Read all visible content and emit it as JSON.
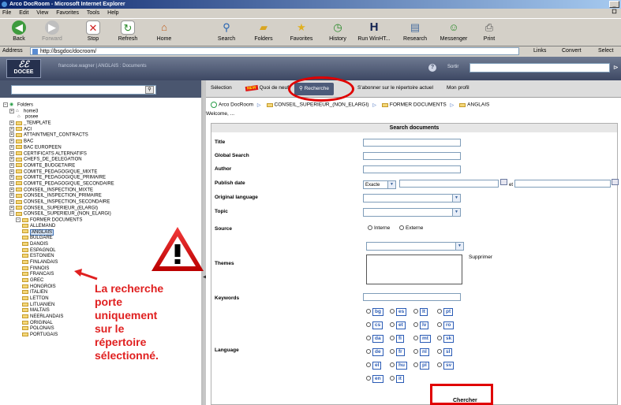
{
  "window": {
    "title": "Arco DocRoom - Microsoft Internet Explorer",
    "controls": "_ ☐"
  },
  "menu": [
    "File",
    "Edit",
    "View",
    "Favorites",
    "Tools",
    "Help"
  ],
  "toolbar": [
    {
      "label": "Back",
      "icon": "back-arrow-icon"
    },
    {
      "label": "Forward",
      "icon": "forward-arrow-icon"
    },
    {
      "label": "Stop",
      "icon": "stop-icon"
    },
    {
      "label": "Refresh",
      "icon": "refresh-icon"
    },
    {
      "label": "Home",
      "icon": "home-icon"
    },
    {
      "label": "Search",
      "icon": "search-icon"
    },
    {
      "label": "Folders",
      "icon": "folder-icon"
    },
    {
      "label": "Favorites",
      "icon": "star-icon"
    },
    {
      "label": "History",
      "icon": "history-icon"
    },
    {
      "label": "Run WinHT...",
      "icon": "h-icon"
    },
    {
      "label": "Research",
      "icon": "research-icon"
    },
    {
      "label": "Messenger",
      "icon": "messenger-icon"
    },
    {
      "label": "Print",
      "icon": "print-icon"
    }
  ],
  "address": {
    "label": "Address",
    "url": "http://bsgdoc/docroom/",
    "links": "Links",
    "convert": "Convert",
    "select": "Select"
  },
  "app": {
    "logo": "DOCEE",
    "user": "francoise.wagner  |  ANGLAIS : Documents",
    "help": "?",
    "logout": "Sortir",
    "go": "⊳"
  },
  "tabs": {
    "selection": "Sélection",
    "new_badge": "NEW",
    "quoi_de_neuf": "Quoi de neuf",
    "recherche": "Recherche",
    "sabonner": "S'abonner sur le répertoire actuel",
    "mon_profil": "Mon profil"
  },
  "breadcrumb": [
    "Arco DocRoom",
    "CONSEIL_SUPERIEUR_(NON_ELARGI)",
    "FORMER DOCUMENTS",
    "ANGLAIS"
  ],
  "welcome": "Welcome, ...",
  "tree": {
    "root": "Folders",
    "items": [
      {
        "label": "home3",
        "depth": 1,
        "type": "home",
        "expander": "+"
      },
      {
        "label": "posee",
        "depth": 1,
        "type": "home",
        "expander": ""
      },
      {
        "label": "_TEMPLATE",
        "depth": 1,
        "type": "folder",
        "expander": "+"
      },
      {
        "label": "ACI",
        "depth": 1,
        "type": "folder",
        "expander": "+"
      },
      {
        "label": "ATTAINTMENT_CONTRACTS",
        "depth": 1,
        "type": "folder",
        "expander": "+"
      },
      {
        "label": "BAC",
        "depth": 1,
        "type": "folder",
        "expander": "+"
      },
      {
        "label": "BAC EUROPEEN",
        "depth": 1,
        "type": "folder",
        "expander": "+"
      },
      {
        "label": "CERTIFICATS ALTERNATIFS",
        "depth": 1,
        "type": "folder",
        "expander": "+"
      },
      {
        "label": "CHEFS_DE_DELEGATION",
        "depth": 1,
        "type": "folder",
        "expander": "+"
      },
      {
        "label": "COMITE_BUDGETAIRE",
        "depth": 1,
        "type": "folder",
        "expander": "+"
      },
      {
        "label": "COMITE_PEDAGOGIQUE_MIXTE",
        "depth": 1,
        "type": "folder",
        "expander": "+"
      },
      {
        "label": "COMITE_PEDAGOGIQUE_PRIMAIRE",
        "depth": 1,
        "type": "folder",
        "expander": "+"
      },
      {
        "label": "COMITE_PEDAGOGIQUE_SECONDAIRE",
        "depth": 1,
        "type": "folder",
        "expander": "+"
      },
      {
        "label": "CONSEIL_INSPECTION_MIXTE",
        "depth": 1,
        "type": "folder",
        "expander": "+"
      },
      {
        "label": "CONSEIL_INSPECTION_PRIMAIRE",
        "depth": 1,
        "type": "folder",
        "expander": "+"
      },
      {
        "label": "CONSEIL_INSPECTION_SECONDAIRE",
        "depth": 1,
        "type": "folder",
        "expander": "+"
      },
      {
        "label": "CONSEIL_SUPERIEUR_(ELARGI)",
        "depth": 1,
        "type": "folder",
        "expander": "+"
      },
      {
        "label": "CONSEIL_SUPERIEUR_(NON_ELARGI)",
        "depth": 1,
        "type": "folder",
        "expander": "−"
      },
      {
        "label": "FORMER DOCUMENTS",
        "depth": 2,
        "type": "folder",
        "expander": "−"
      },
      {
        "label": "ALLEMAND",
        "depth": 3,
        "type": "folder",
        "expander": ""
      },
      {
        "label": "ANGLAIS",
        "depth": 3,
        "type": "folder",
        "expander": "",
        "selected": true
      },
      {
        "label": "BULGARE",
        "depth": 3,
        "type": "folder",
        "expander": ""
      },
      {
        "label": "DANOIS",
        "depth": 3,
        "type": "folder",
        "expander": ""
      },
      {
        "label": "ESPAGNOL",
        "depth": 3,
        "type": "folder",
        "expander": ""
      },
      {
        "label": "ESTONIEN",
        "depth": 3,
        "type": "folder",
        "expander": ""
      },
      {
        "label": "FINLANDAIS",
        "depth": 3,
        "type": "folder",
        "expander": ""
      },
      {
        "label": "FINNOIS",
        "depth": 3,
        "type": "folder",
        "expander": ""
      },
      {
        "label": "FRANCAIS",
        "depth": 3,
        "type": "folder",
        "expander": ""
      },
      {
        "label": "GREC",
        "depth": 3,
        "type": "folder",
        "expander": ""
      },
      {
        "label": "HONGROIS",
        "depth": 3,
        "type": "folder",
        "expander": ""
      },
      {
        "label": "ITALIEN",
        "depth": 3,
        "type": "folder",
        "expander": ""
      },
      {
        "label": "LETTON",
        "depth": 3,
        "type": "folder",
        "expander": ""
      },
      {
        "label": "LITUANIEN",
        "depth": 3,
        "type": "folder",
        "expander": ""
      },
      {
        "label": "MALTAIS",
        "depth": 3,
        "type": "folder",
        "expander": ""
      },
      {
        "label": "NEERLANDAIS",
        "depth": 3,
        "type": "folder",
        "expander": ""
      },
      {
        "label": "ORIGINAL",
        "depth": 3,
        "type": "folder",
        "expander": ""
      },
      {
        "label": "POLONAIS",
        "depth": 3,
        "type": "folder",
        "expander": ""
      },
      {
        "label": "PORTUGAIS",
        "depth": 3,
        "type": "folder",
        "expander": ""
      }
    ]
  },
  "annotation": {
    "text_lines": [
      "La recherche",
      "porte",
      "uniquement",
      "sur le",
      "répertoire",
      "sélectionné."
    ],
    "color": "#e02020",
    "icon": "warning-triangle-icon"
  },
  "form": {
    "header": "Search documents",
    "title_label": "Title",
    "global_label": "Global Search",
    "author_label": "Author",
    "publish_label": "Publish date",
    "publish_mode": "Exacte",
    "et": "et",
    "orig_lang_label": "Original language",
    "topic_label": "Topic",
    "source_label": "Source",
    "source_interne": "Interne",
    "source_externe": "Externe",
    "themes_label": "Themes",
    "supprimer": "Supprimer",
    "keywords_label": "Keywords",
    "language_label": "Language",
    "lang_rows": [
      [
        "bg",
        "es",
        "lt",
        "pt"
      ],
      [
        "cs",
        "et",
        "lv",
        "ro"
      ],
      [
        "da",
        "fi",
        "mt",
        "sk"
      ],
      [
        "de",
        "fr",
        "nl",
        "sl"
      ],
      [
        "el",
        "hu",
        "pl",
        "sv"
      ],
      [
        "en",
        "it"
      ]
    ],
    "submit": "Chercher"
  },
  "colors": {
    "accent_red": "#e00000",
    "header_blue": "#4d5b7a",
    "link_blue": "#2a5bb5"
  }
}
